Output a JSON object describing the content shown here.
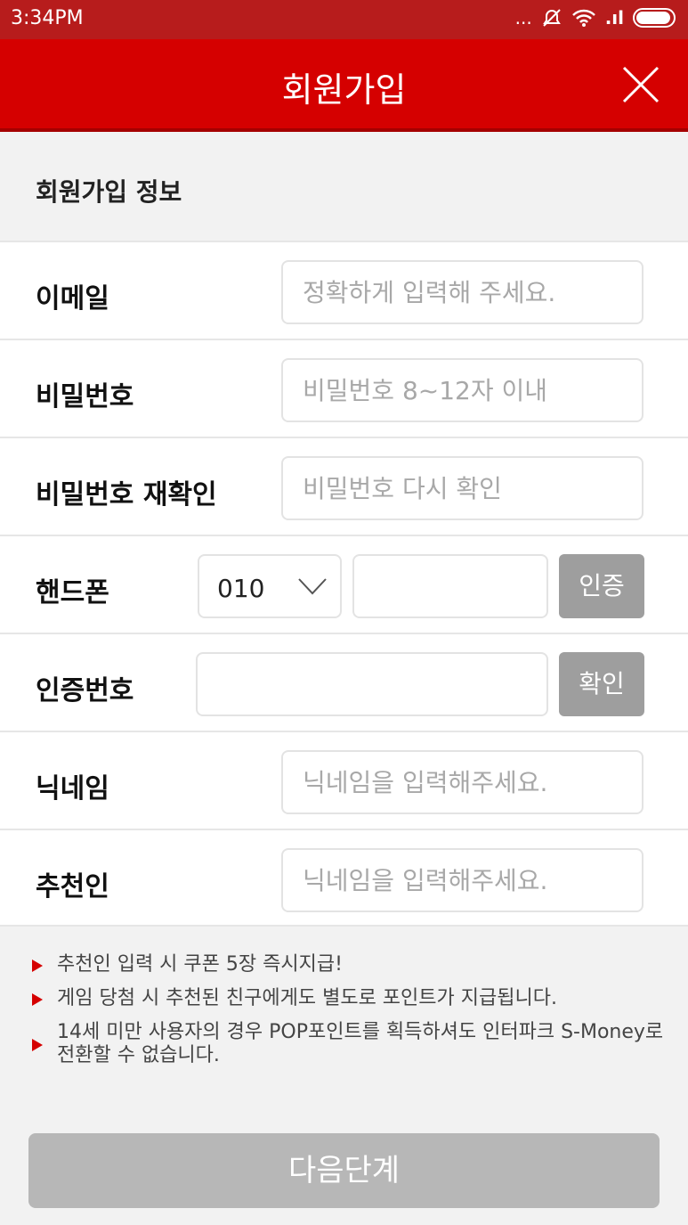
{
  "status_bar": {
    "time": "3:34PM",
    "dots": "...",
    "signal": ".ıl"
  },
  "header": {
    "title": "회원가입"
  },
  "section": {
    "title": "회원가입 정보"
  },
  "form": {
    "email": {
      "label": "이메일",
      "placeholder": "정확하게 입력해 주세요."
    },
    "password": {
      "label": "비밀번호",
      "placeholder": "비밀번호 8~12자 이내"
    },
    "password_confirm": {
      "label": "비밀번호 재확인",
      "placeholder": "비밀번호 다시 확인"
    },
    "phone": {
      "label": "핸드폰",
      "prefix_selected": "010",
      "verify_button": "인증"
    },
    "verification": {
      "label": "인증번호",
      "confirm_button": "확인"
    },
    "nickname": {
      "label": "닉네임",
      "placeholder": "닉네임을 입력해주세요."
    },
    "referrer": {
      "label": "추천인",
      "placeholder": "닉네임을 입력해주세요."
    }
  },
  "notes": [
    "추천인 입력 시 쿠폰 5장 즉시지급!",
    "게임 당첨 시 추천된 친구에게도 별도로 포인트가 지급됩니다.",
    "14세 미만 사용자의 경우 POP포인트를 획득하셔도 인터파크 S-Money로 전환할 수 없습니다."
  ],
  "next_button": "다음단계",
  "colors": {
    "header": "#d50000",
    "status_bar": "#b71c1c",
    "button_gray": "#9e9e9e",
    "next_button": "#b7b7b7"
  }
}
